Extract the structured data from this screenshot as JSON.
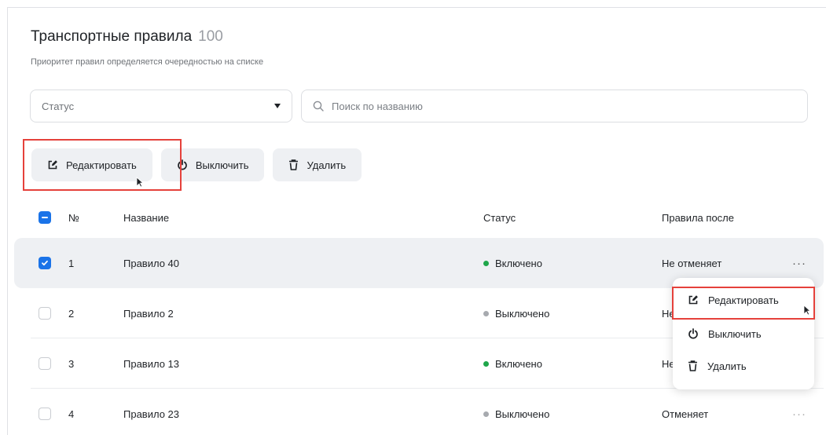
{
  "page": {
    "title": "Транспортные правила",
    "count": "100",
    "subtitle": "Приоритет правил определяется очередностью на списке"
  },
  "filters": {
    "status_label": "Статус",
    "search_placeholder": "Поиск по названию"
  },
  "toolbar": {
    "edit_label": "Редактировать",
    "disable_label": "Выключить",
    "delete_label": "Удалить"
  },
  "table": {
    "headers": {
      "num": "№",
      "name": "Название",
      "status": "Статус",
      "after": "Правила после"
    },
    "rows": [
      {
        "num": "1",
        "name": "Правило 40",
        "status": "Включено",
        "after": "Не отменяет",
        "checked": true
      },
      {
        "num": "2",
        "name": "Правило 2",
        "status": "Выключено",
        "after": "Не отменяет",
        "checked": false
      },
      {
        "num": "3",
        "name": "Правило 13",
        "status": "Включено",
        "after": "Не отменяет",
        "checked": false
      },
      {
        "num": "4",
        "name": "Правило 23",
        "status": "Выключено",
        "after": "Отменяет",
        "checked": false
      }
    ]
  },
  "row_menu": {
    "more_label": "···",
    "edit_label": "Редактировать",
    "disable_label": "Выключить",
    "delete_label": "Удалить"
  },
  "colors": {
    "accent": "#1a73e8",
    "enabled": "#1fa64a",
    "disabled": "#a7aaaf",
    "highlight": "#e5413b"
  }
}
